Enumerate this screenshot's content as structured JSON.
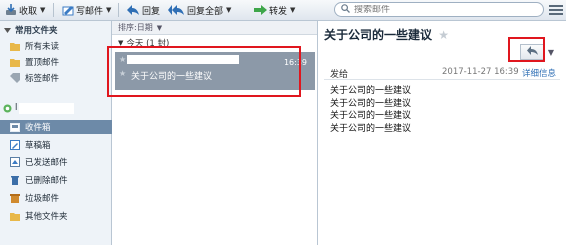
{
  "toolbar": {
    "receive": "收取",
    "compose": "写邮件",
    "reply": "回复",
    "reply_all": "回复全部",
    "forward": "转发",
    "search_placeholder": "搜索邮件"
  },
  "sidebar": {
    "section_title": "常用文件夹",
    "quick_items": [
      {
        "label": "所有未读",
        "icon": "folder-icon"
      },
      {
        "label": "置顶邮件",
        "icon": "folder-icon"
      },
      {
        "label": "标签邮件",
        "icon": "tag-icon"
      }
    ],
    "account_label": "l",
    "folders": [
      {
        "label": "收件箱",
        "icon": "inbox-icon",
        "active": true
      },
      {
        "label": "草稿箱",
        "icon": "draft-icon"
      },
      {
        "label": "已发送邮件",
        "icon": "sent-icon"
      },
      {
        "label": "已删除邮件",
        "icon": "trash-icon"
      },
      {
        "label": "垃圾邮件",
        "icon": "spam-icon"
      },
      {
        "label": "其他文件夹",
        "icon": "folder-icon"
      }
    ]
  },
  "list": {
    "sort_label": "排序:日期",
    "group_label": "今天 (1 封)",
    "message": {
      "time": "16:39",
      "subject": "关于公司的一些建议"
    }
  },
  "reader": {
    "subject": "关于公司的一些建议",
    "from_label": "发给",
    "datetime": "2017-11-27 16:39",
    "details_link": "详细信息",
    "body_lines": [
      "关于公司的一些建议",
      "关于公司的一些建议",
      "关于公司的一些建议",
      "关于公司的一些建议"
    ]
  },
  "colors": {
    "accent": "#6d8aa8",
    "selected_row": "#8c99a8",
    "highlight": "#e0161e"
  }
}
